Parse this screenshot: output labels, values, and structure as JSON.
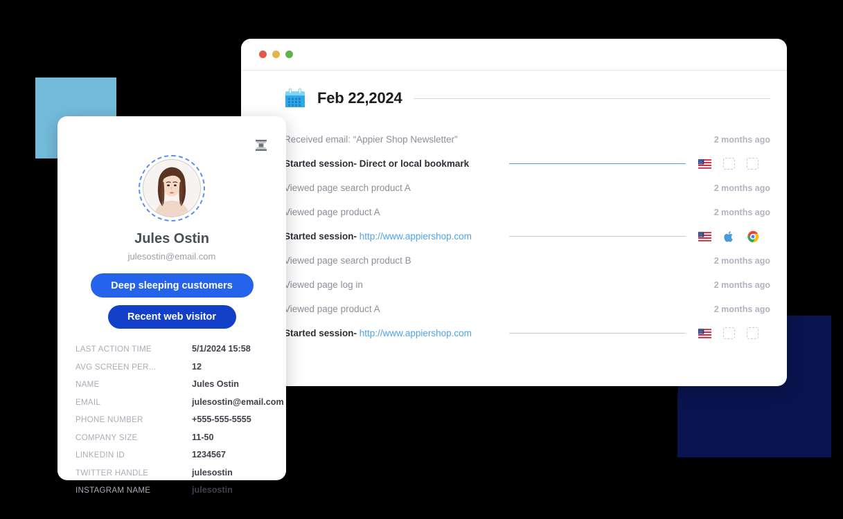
{
  "decor": {
    "square_color": "#74BBDB",
    "navy_color": "#0A1550"
  },
  "window": {
    "traffic_lights": [
      "#E2574C",
      "#E8B24A",
      "#5FB04E"
    ],
    "date_label": "Feb 22,2024",
    "calendar_icon": "calendar-icon",
    "rows": [
      {
        "icon": "envelope-icon",
        "label": "Received email: “Appier Shop Newsletter”",
        "bold": false,
        "time": "2 months ago",
        "trailing": "time"
      },
      {
        "icon": null,
        "label": "Started session- ",
        "link": "Direct or local bookmark",
        "link_is_url": false,
        "bold": true,
        "trailing": "meta",
        "connector": "blue",
        "meta": [
          "us-flag-icon",
          "placeholder-icon",
          "placeholder-icon"
        ]
      },
      {
        "icon": "monitor-icon",
        "label": "Viewed page search product A",
        "bold": false,
        "time": "2 months ago",
        "trailing": "time"
      },
      {
        "icon": null,
        "label": "Viewed page product A",
        "bold": false,
        "time": "2 months ago",
        "trailing": "time"
      },
      {
        "icon": "mobile-icon",
        "label": "Started session- ",
        "link": "http://www.appiershop.com",
        "link_is_url": true,
        "bold": true,
        "trailing": "meta",
        "connector": "gray",
        "meta": [
          "us-flag-icon",
          "apple-icon",
          "chrome-icon"
        ]
      },
      {
        "icon": null,
        "label": "Viewed page search product B",
        "bold": false,
        "time": "2 months ago",
        "trailing": "time"
      },
      {
        "icon": null,
        "label": "Viewed page log in",
        "bold": false,
        "time": "2 months ago",
        "trailing": "time"
      },
      {
        "icon": null,
        "label": "Viewed page product A",
        "bold": false,
        "time": "2 months ago",
        "trailing": "time"
      },
      {
        "icon": null,
        "label": "Started session- ",
        "link": "http://www.appiershop.com",
        "link_is_url": true,
        "bold": true,
        "trailing": "meta",
        "connector": "gray",
        "meta": [
          "us-flag-icon",
          "placeholder-icon",
          "placeholder-icon"
        ]
      }
    ]
  },
  "profile": {
    "archive_icon": "archive-icon",
    "avatar": "avatar-photo",
    "name": "Jules Ostin",
    "email": "julesostin@email.com",
    "tag_primary": "Deep sleeping customers",
    "tag_secondary": "Recent web visitor",
    "tag_primary_color": "#2563EB",
    "tag_secondary_color": "#1340C8",
    "details": [
      {
        "key": "LAST ACTION TIME",
        "value": "5/1/2024 15:58"
      },
      {
        "key": "AVG SCREEN PER...",
        "value": "12"
      },
      {
        "key": "NAME",
        "value": "Jules Ostin"
      },
      {
        "key": "EMAIL",
        "value": "julesostin@email.com"
      },
      {
        "key": "PHONE NUMBER",
        "value": "+555-555-5555"
      },
      {
        "key": "COMPANY SIZE",
        "value": "11-50"
      },
      {
        "key": "LINKEDIN ID",
        "value": "1234567"
      },
      {
        "key": "TWITTER HANDLE",
        "value": "julesostin"
      },
      {
        "key": "INSTAGRAM NAME",
        "value": "julesostin"
      }
    ]
  }
}
